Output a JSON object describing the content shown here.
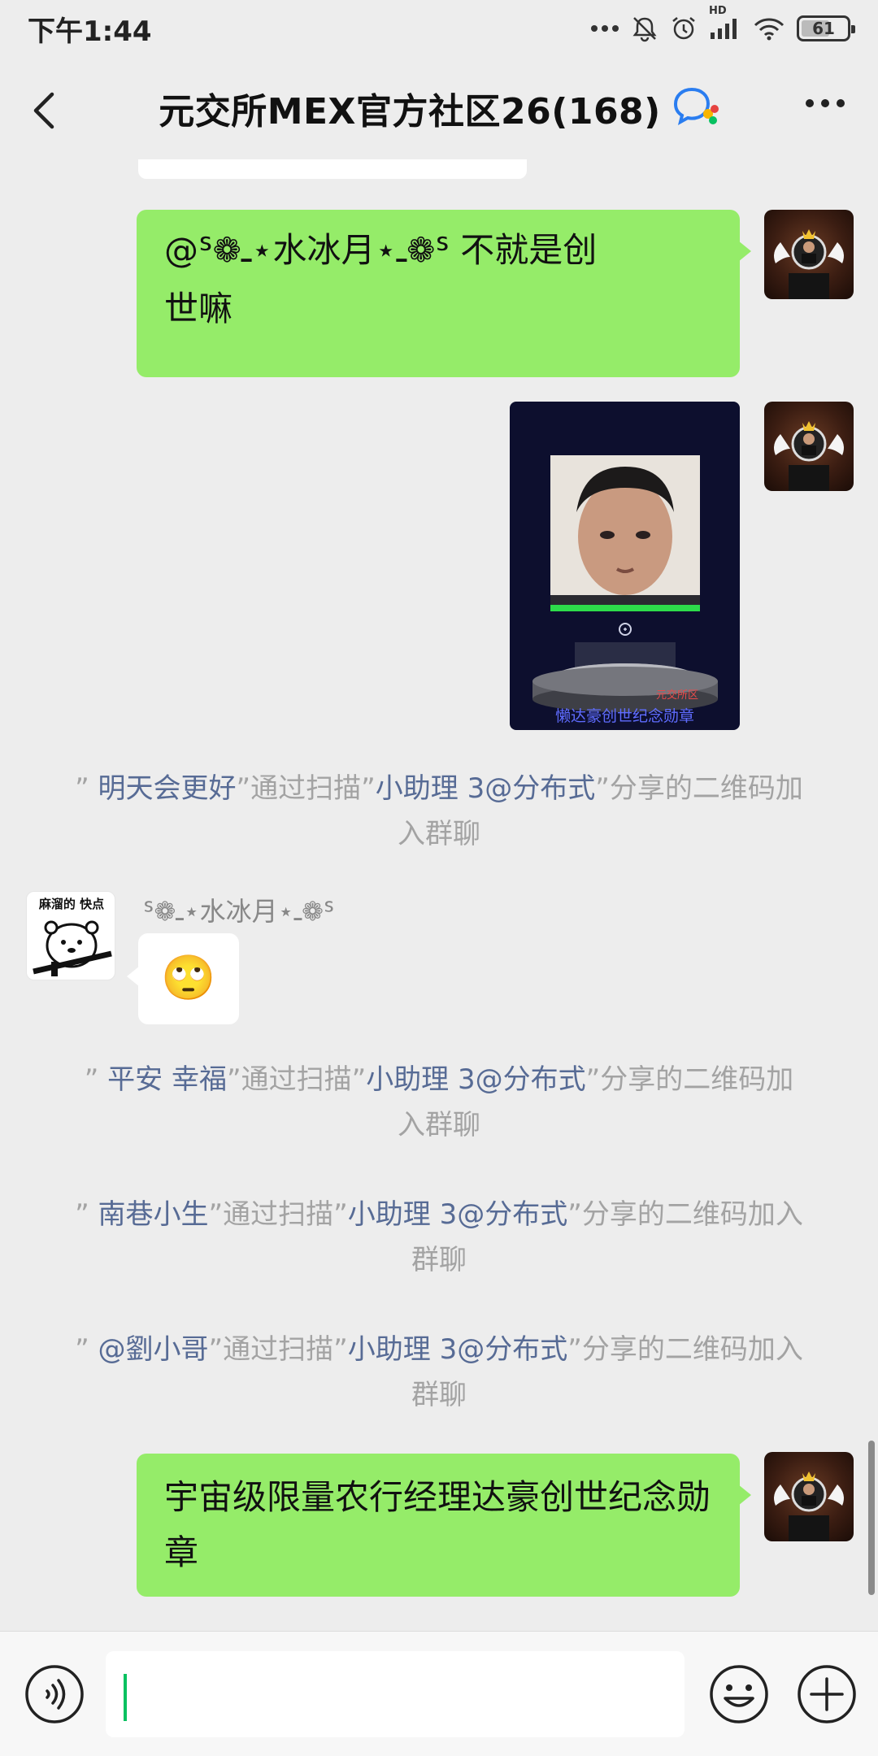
{
  "status_bar": {
    "time": "下午1:44",
    "battery": "61",
    "network": "HD"
  },
  "header": {
    "title": "元交所MEX官方社区26(168)"
  },
  "messages": {
    "msg1_line1": "@ᔆ❁ـ⋆水冰月⋆ـ❁ᔆ 不就是创",
    "msg1_line2": "世嘛",
    "image_caption": "懒达豪创世纪念勋章",
    "image_watermark": "元交所区",
    "system1": {
      "q1": "” ",
      "name": "明天会更好",
      "mid": "”通过扫描”",
      "via": "小助理 3@分布式",
      "tail": "”分享的二维码加入群聊"
    },
    "sender2_name": "ᔆ❁ـ⋆水冰月⋆ـ❁ᔆ",
    "bear_caption": "麻溜的 快点",
    "emoji": "🙄",
    "system2": {
      "q1": "” ",
      "name": "平安 幸福",
      "mid": "”通过扫描”",
      "via": "小助理 3@分布式",
      "tail": "”分享的二维码加入群聊"
    },
    "system3": {
      "q1": "” ",
      "name": "南巷小生",
      "mid": "”通过扫描”",
      "via": "小助理 3@分布式",
      "tail": "”分享的二维码加入群聊"
    },
    "system4": {
      "q1": "” ",
      "name": "@劉小哥",
      "mid": "”通过扫描”",
      "via": "小助理 3@分布式",
      "tail": "”分享的二维码加入群聊"
    },
    "msg_last": "宇宙级限量农行经理达豪创世纪念勋章"
  },
  "input": {
    "value": ""
  },
  "colors": {
    "bubble_green": "#95ec69",
    "system_name": "#576b95",
    "background": "#ededed"
  }
}
